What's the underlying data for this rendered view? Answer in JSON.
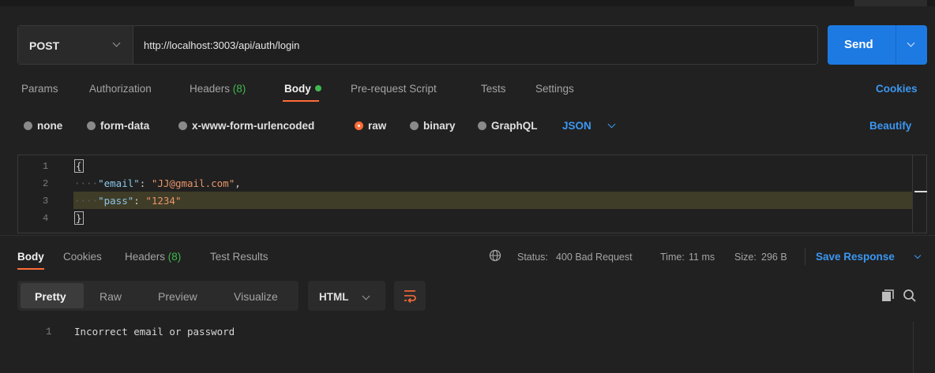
{
  "request": {
    "method": "POST",
    "url": "http://localhost:3003/api/auth/login",
    "send_label": "Send"
  },
  "request_tabs": {
    "params": "Params",
    "authorization": "Authorization",
    "headers": "Headers",
    "headers_count": "(8)",
    "body": "Body",
    "pre_request": "Pre-request Script",
    "tests": "Tests",
    "settings": "Settings",
    "cookies": "Cookies"
  },
  "body_types": {
    "none": "none",
    "form_data": "form-data",
    "urlencoded": "x-www-form-urlencoded",
    "raw": "raw",
    "binary": "binary",
    "graphql": "GraphQL",
    "language": "JSON",
    "beautify": "Beautify",
    "selected": "raw"
  },
  "editor": {
    "line_numbers": [
      "1",
      "2",
      "3",
      "4"
    ],
    "open_brace": "{",
    "close_brace": "}",
    "indent": "····",
    "line2": {
      "key": "\"email\"",
      "colon": ": ",
      "value": "\"JJ@gmail.com\"",
      "comma": ","
    },
    "line3": {
      "key": "\"pass\"",
      "colon": ": ",
      "value": "\"1234\""
    }
  },
  "response_tabs": {
    "body": "Body",
    "cookies": "Cookies",
    "headers": "Headers",
    "headers_count": "(8)",
    "test_results": "Test Results"
  },
  "status": {
    "status_label": "Status:",
    "status_value": "400 Bad Request",
    "time_label": "Time:",
    "time_value": "11 ms",
    "size_label": "Size:",
    "size_value": "296 B",
    "save_response": "Save Response"
  },
  "view_modes": {
    "pretty": "Pretty",
    "raw": "Raw",
    "preview": "Preview",
    "visualize": "Visualize",
    "format": "HTML"
  },
  "response_body": {
    "line_number": "1",
    "text": "Incorrect email or password"
  },
  "colors": {
    "accent": "#ff6c37",
    "send_blue": "#1d7ae3",
    "link_blue": "#3c97f2",
    "success_green": "#3fb950"
  }
}
